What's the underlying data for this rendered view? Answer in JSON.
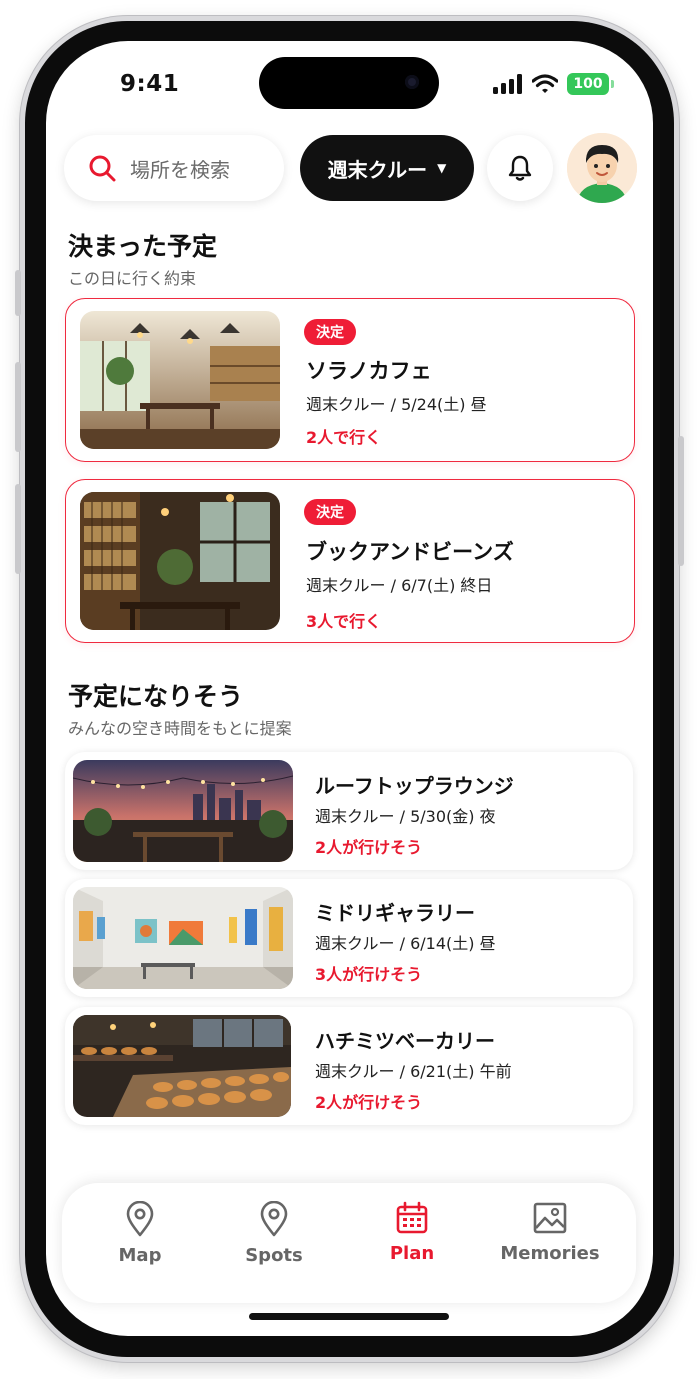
{
  "status_bar": {
    "time": "9:41",
    "battery": "100"
  },
  "search": {
    "placeholder": "場所を検索"
  },
  "group_selector": {
    "label": "週末クルー"
  },
  "sections": {
    "decided": {
      "title": "決まった予定",
      "subtitle": "この日に行く約束"
    },
    "likely": {
      "title": "予定になりそう",
      "subtitle": "みんなの空き時間をもとに提案"
    }
  },
  "decided_items": [
    {
      "badge": "決定",
      "name": "ソラノカフェ",
      "meta": "週末クルー / 5/24(土) 昼",
      "status": "2人で行く"
    },
    {
      "badge": "決定",
      "name": "ブックアンドビーンズ",
      "meta": "週末クルー / 6/7(土) 終日",
      "status": "3人で行く"
    }
  ],
  "suggested_items": [
    {
      "name": "ルーフトップラウンジ",
      "meta": "週末クルー / 5/30(金) 夜",
      "status": "2人が行けそう"
    },
    {
      "name": "ミドリギャラリー",
      "meta": "週末クルー / 6/14(土) 昼",
      "status": "3人が行けそう"
    },
    {
      "name": "ハチミツベーカリー",
      "meta": "週末クルー / 6/21(土) 午前",
      "status": "2人が行けそう"
    }
  ],
  "nav": {
    "items": [
      {
        "label": "Map",
        "icon": "map-pin-icon"
      },
      {
        "label": "Spots",
        "icon": "location-pin-icon"
      },
      {
        "label": "Plan",
        "icon": "calendar-icon",
        "active": true
      },
      {
        "label": "Memories",
        "icon": "image-icon"
      }
    ]
  },
  "colors": {
    "accent": "#e8192f",
    "badge": "#ef1d36",
    "dark_pill": "#111111",
    "battery": "#34c759"
  }
}
